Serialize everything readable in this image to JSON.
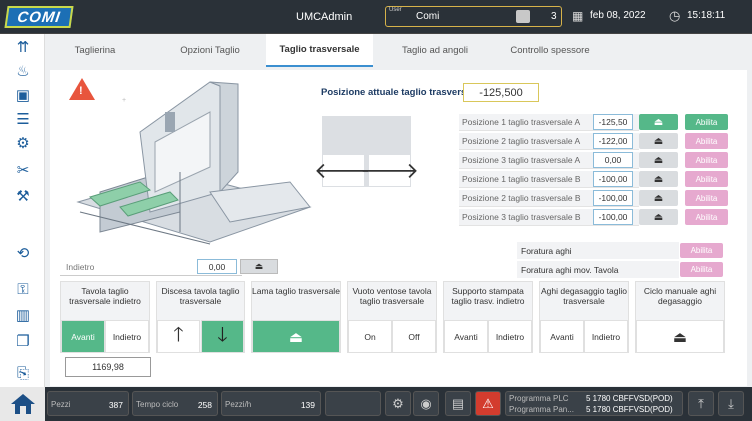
{
  "header": {
    "logo": "COMI",
    "app_title": "UMCAdmin",
    "user_caption": "User",
    "user_name": "Comi",
    "user_level": "3",
    "date": "feb 08, 2022",
    "time": "15:18:11"
  },
  "tabs": [
    {
      "label": "Taglierina",
      "active": false
    },
    {
      "label": "Opzioni Taglio",
      "active": false
    },
    {
      "label": "Taglio trasversale",
      "active": true
    },
    {
      "label": "Taglio ad angoli",
      "active": false
    },
    {
      "label": "Controllo spessore",
      "active": false
    }
  ],
  "current_position": {
    "label": "Posizione attuale taglio trasversale",
    "value": "-125,500"
  },
  "positions": [
    {
      "label": "Posizione 1 taglio trasversale A",
      "value": "-125,50",
      "abilita": "Abilita",
      "active": true
    },
    {
      "label": "Posizione 2 taglio trasversale A",
      "value": "-122,00",
      "abilita": "Abilita",
      "active": false
    },
    {
      "label": "Posizione 3 taglio trasversale A",
      "value": "0,00",
      "abilita": "Abilita",
      "active": false
    },
    {
      "label": "Posizione 1 taglio trasversale B",
      "value": "-100,00",
      "abilita": "Abilita",
      "active": false
    },
    {
      "label": "Posizione 2 taglio trasversale B",
      "value": "-100,00",
      "abilita": "Abilita",
      "active": false
    },
    {
      "label": "Posizione 3 taglio trasversale B",
      "value": "-100,00",
      "abilita": "Abilita",
      "active": false
    }
  ],
  "foratura": [
    {
      "label": "Foratura aghi",
      "abilita": "Abilita"
    },
    {
      "label": "Foratura aghi mov. Tavola",
      "abilita": "Abilita"
    }
  ],
  "indietro": {
    "label": "Indietro",
    "value": "0,00"
  },
  "cards": {
    "tavola": {
      "title": "Tavola taglio trasversale indietro",
      "avanti": "Avanti",
      "indietro": "Indietro",
      "value": "1169,98"
    },
    "discesa": {
      "title": "Discesa tavola taglio trasversale"
    },
    "lama": {
      "title": "Lama taglio trasversale"
    },
    "vuoto": {
      "title": "Vuoto ventose tavola taglio trasversale",
      "on": "On",
      "off": "Off"
    },
    "supporto": {
      "title": "Supporto stampata taglio trasv. indietro",
      "avanti": "Avanti",
      "indietro": "Indietro"
    },
    "aghi": {
      "title": "Aghi degasaggio taglio trasversale",
      "avanti": "Avanti",
      "indietro": "Indietro"
    },
    "ciclo": {
      "title": "Ciclo manuale aghi degasaggio"
    }
  },
  "footer": {
    "pezzi_label": "Pezzi",
    "pezzi_value": "387",
    "tempo_label": "Tempo ciclo",
    "tempo_value": "258",
    "pezzih_label": "Pezzi/h",
    "pezzih_value": "139",
    "plc_label": "Programma PLC",
    "plc_value": "5  1780 CBFFVSD(POD)",
    "pan_label": "Programma Pan...",
    "pan_value": "5  1780 CBFFVSD(POD)"
  },
  "colors": {
    "accent": "#3b8fd0",
    "green": "#55b889",
    "pink": "#e6a9cf",
    "header": "#2a3138"
  }
}
